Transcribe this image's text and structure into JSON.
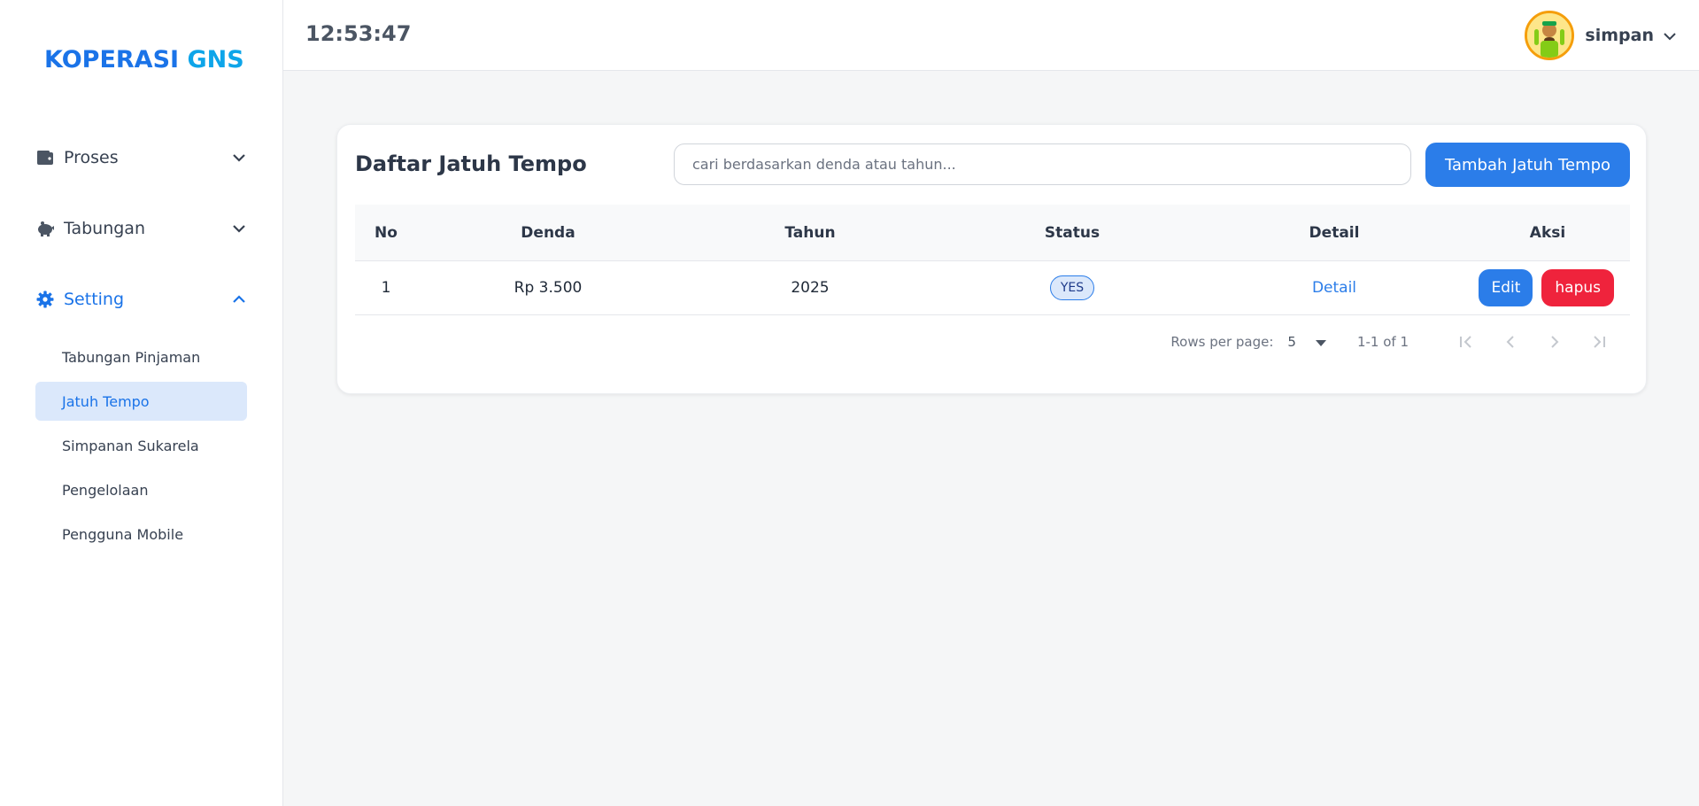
{
  "brand": {
    "part1": "KOPERASI",
    "part2": "GNS",
    "colors": {
      "part1": "#1a73e8",
      "part2": "#0ea5e9"
    }
  },
  "sidebar": {
    "menus": [
      {
        "label": "Proses",
        "icon": "wallet-icon",
        "expanded": false
      },
      {
        "label": "Tabungan",
        "icon": "piggy-bank-icon",
        "expanded": false
      },
      {
        "label": "Setting",
        "icon": "gear-icon",
        "expanded": true,
        "active": true
      }
    ],
    "sub_items": [
      {
        "label": "Tabungan Pinjaman",
        "active": false
      },
      {
        "label": "Jatuh Tempo",
        "active": true
      },
      {
        "label": "Simpanan Sukarela",
        "active": false
      },
      {
        "label": "Pengelolaan",
        "active": false
      },
      {
        "label": "Pengguna Mobile",
        "active": false
      }
    ]
  },
  "header": {
    "clock": "12:53:47",
    "username": "simpan"
  },
  "main": {
    "title": "Daftar Jatuh Tempo",
    "search_placeholder": "cari berdasarkan denda atau tahun...",
    "add_button": "Tambah Jatuh Tempo",
    "columns": [
      "No",
      "Denda",
      "Tahun",
      "Status",
      "Detail",
      "Aksi"
    ],
    "rows": [
      {
        "no": "1",
        "denda": "Rp 3.500",
        "tahun": "2025",
        "status": "YES",
        "detail": "Detail",
        "edit": "Edit",
        "hapus": "hapus"
      }
    ],
    "pagination": {
      "rows_per_page_label": "Rows per page:",
      "rows_per_page": "5",
      "range": "1-1 of 1"
    }
  },
  "colors": {
    "primary": "#2b7de9",
    "danger": "#ef233c",
    "active_bg": "#dbe8fb"
  }
}
